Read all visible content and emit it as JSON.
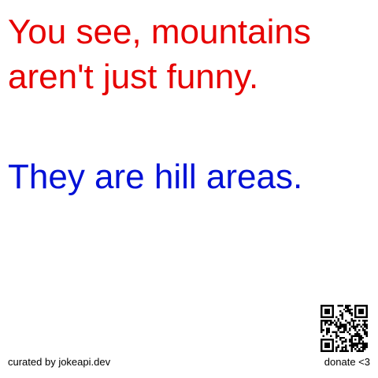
{
  "joke": {
    "setup": "You see, mountains aren't just funny.",
    "punchline": "They are hill areas."
  },
  "footer": {
    "credit": "curated by jokeapi.dev",
    "donate": "donate <3"
  },
  "colors": {
    "setup": "#e60000",
    "punchline": "#0010d6",
    "background": "#ffffff",
    "footer_text": "#000000"
  },
  "icons": {
    "qr": "qr-code-icon"
  }
}
